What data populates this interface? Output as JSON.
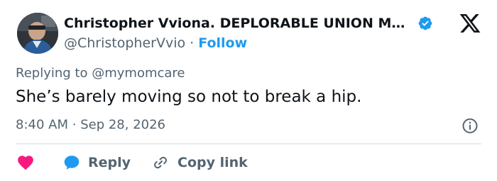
{
  "author": {
    "display_name": "Christopher Vviona. DEPLORABLE UNION MEM...",
    "handle": "@ChristopherVvio",
    "separator": "·",
    "follow_label": "Follow"
  },
  "tweet": {
    "replying_to_prefix": "Replying to",
    "replying_to_handle": "@mymomcare",
    "text": "She’s barely moving so not to break a hip.",
    "time": "8:40 AM",
    "meta_separator": "·",
    "date": "Sep 28, 2026"
  },
  "actions": {
    "reply_label": "Reply",
    "copy_link_label": "Copy link"
  },
  "icons": {
    "avatar": "avatar",
    "verified": "verified-badge-icon",
    "brand": "x-logo-icon",
    "info": "info-icon",
    "like": "heart-icon",
    "reply": "reply-bubble-icon",
    "copy": "link-icon"
  },
  "colors": {
    "accent": "#1d9bf0",
    "like": "#f91880",
    "text_primary": "#0f1419",
    "text_secondary": "#536471",
    "divider": "#cfd9de"
  }
}
